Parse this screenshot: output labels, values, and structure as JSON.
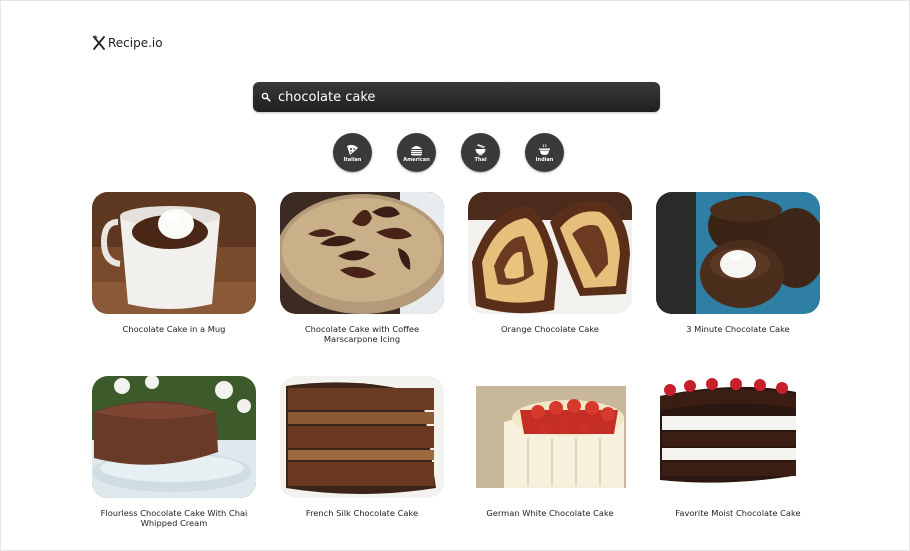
{
  "app": {
    "logo_text": "Recipe.io"
  },
  "search": {
    "value": "chocolate cake",
    "placeholder": ""
  },
  "cuisines": [
    {
      "label": "Italian",
      "icon": "pizza-icon"
    },
    {
      "label": "American",
      "icon": "burger-icon"
    },
    {
      "label": "Thai",
      "icon": "noodle-bowl-icon"
    },
    {
      "label": "Indian",
      "icon": "curry-pot-icon"
    }
  ],
  "recipes": [
    {
      "title": "Chocolate Cake in a Mug"
    },
    {
      "title": "Chocolate Cake with Coffee Marscarpone Icing"
    },
    {
      "title": "Orange Chocolate Cake"
    },
    {
      "title": "3 Minute Chocolate Cake"
    },
    {
      "title": "Flourless Chocolate Cake With Chai Whipped Cream"
    },
    {
      "title": "French Silk Chocolate Cake"
    },
    {
      "title": "German White Chocolate Cake"
    },
    {
      "title": "Favorite Moist Chocolate Cake"
    }
  ]
}
